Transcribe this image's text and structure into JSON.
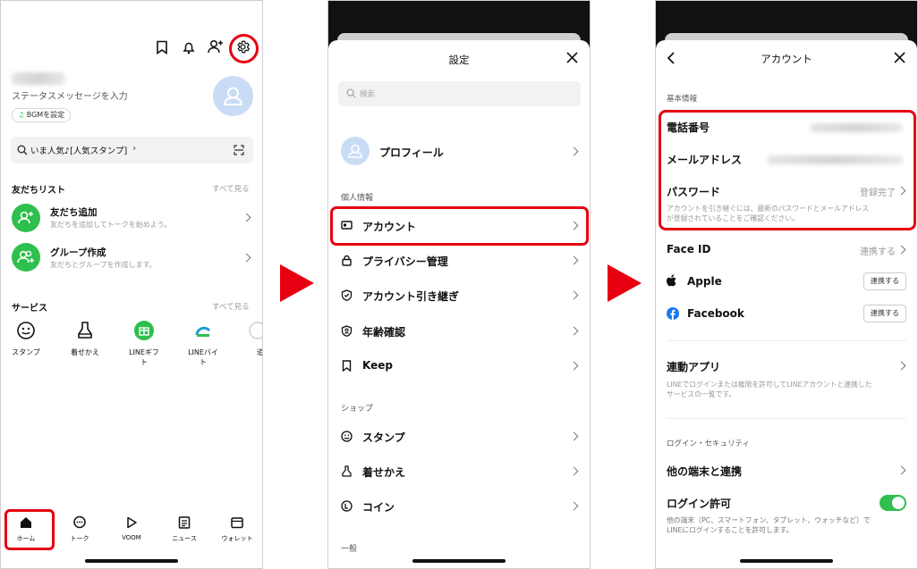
{
  "panel1": {
    "status_message": "ステータスメッセージを入力",
    "bgm_button": "BGMを設定",
    "search_text": "いま人気♪[人気スタンプ]",
    "search_chevron": "›",
    "friends_section": {
      "title": "友だちリスト",
      "see_all": "すべて見る",
      "items": [
        {
          "title": "友だち追加",
          "subtitle": "友だちを追加してトークを始めよう。"
        },
        {
          "title": "グループ作成",
          "subtitle": "友だちとグループを作成します。"
        }
      ]
    },
    "services_section": {
      "title": "サービス",
      "see_all": "すべて見る",
      "items": [
        {
          "label": "スタンプ",
          "icon": "smile-icon"
        },
        {
          "label": "着せかえ",
          "icon": "theme-icon"
        },
        {
          "label": "LINEギフト",
          "icon": "gift-icon"
        },
        {
          "label": "LINEバイト",
          "icon": "line-baito-icon"
        }
      ],
      "partial_item": "追"
    },
    "tabbar": [
      {
        "label": "ホーム",
        "icon": "home-icon"
      },
      {
        "label": "トーク",
        "icon": "chat-icon"
      },
      {
        "label": "VOOM",
        "icon": "voom-icon"
      },
      {
        "label": "ニュース",
        "icon": "news-icon"
      },
      {
        "label": "ウォレット",
        "icon": "wallet-icon"
      }
    ]
  },
  "panel2": {
    "title": "設定",
    "search_placeholder": "検索",
    "profile": "プロフィール",
    "section_personal": "個人情報",
    "personal_items": [
      "アカウント",
      "プライバシー管理",
      "アカウント引き継ぎ",
      "年齢確認",
      "Keep"
    ],
    "section_shop": "ショップ",
    "shop_items": [
      "スタンプ",
      "着せかえ",
      "コイン"
    ],
    "section_general": "一般"
  },
  "panel3": {
    "title": "アカウント",
    "section_basic": "基本情報",
    "phone_label": "電話番号",
    "email_label": "メールアドレス",
    "password_label": "パスワード",
    "password_value": "登録完了",
    "password_note_line1": "アカウントを引き継ぐには、最新のパスワードとメールアドレス",
    "password_note_line2": "が登録されていることをご確認ください。",
    "faceid_label": "Face ID",
    "faceid_value": "連携する",
    "apple_label": "Apple",
    "apple_button": "連携する",
    "facebook_label": "Facebook",
    "facebook_button": "連携する",
    "linked_apps_label": "連動アプリ",
    "linked_apps_note_line1": "LINEでログインまたは権限を許可してLINEアカウントと連携した",
    "linked_apps_note_line2": "サービスの一覧です。",
    "section_security": "ログイン・セキュリティ",
    "other_devices_label": "他の端末と連携",
    "login_allow_label": "ログイン許可",
    "login_allow_note_line1": "他の端末（PC、スマートフォン、タブレット、ウォッチなど）で",
    "login_allow_note_line2": "LINEにログインすることを許可します。"
  },
  "colors": {
    "highlight_red": "#e60012",
    "line_green": "#2fbf4e",
    "avatar_blue": "#c9dcf6",
    "facebook_blue": "#1877f2"
  }
}
